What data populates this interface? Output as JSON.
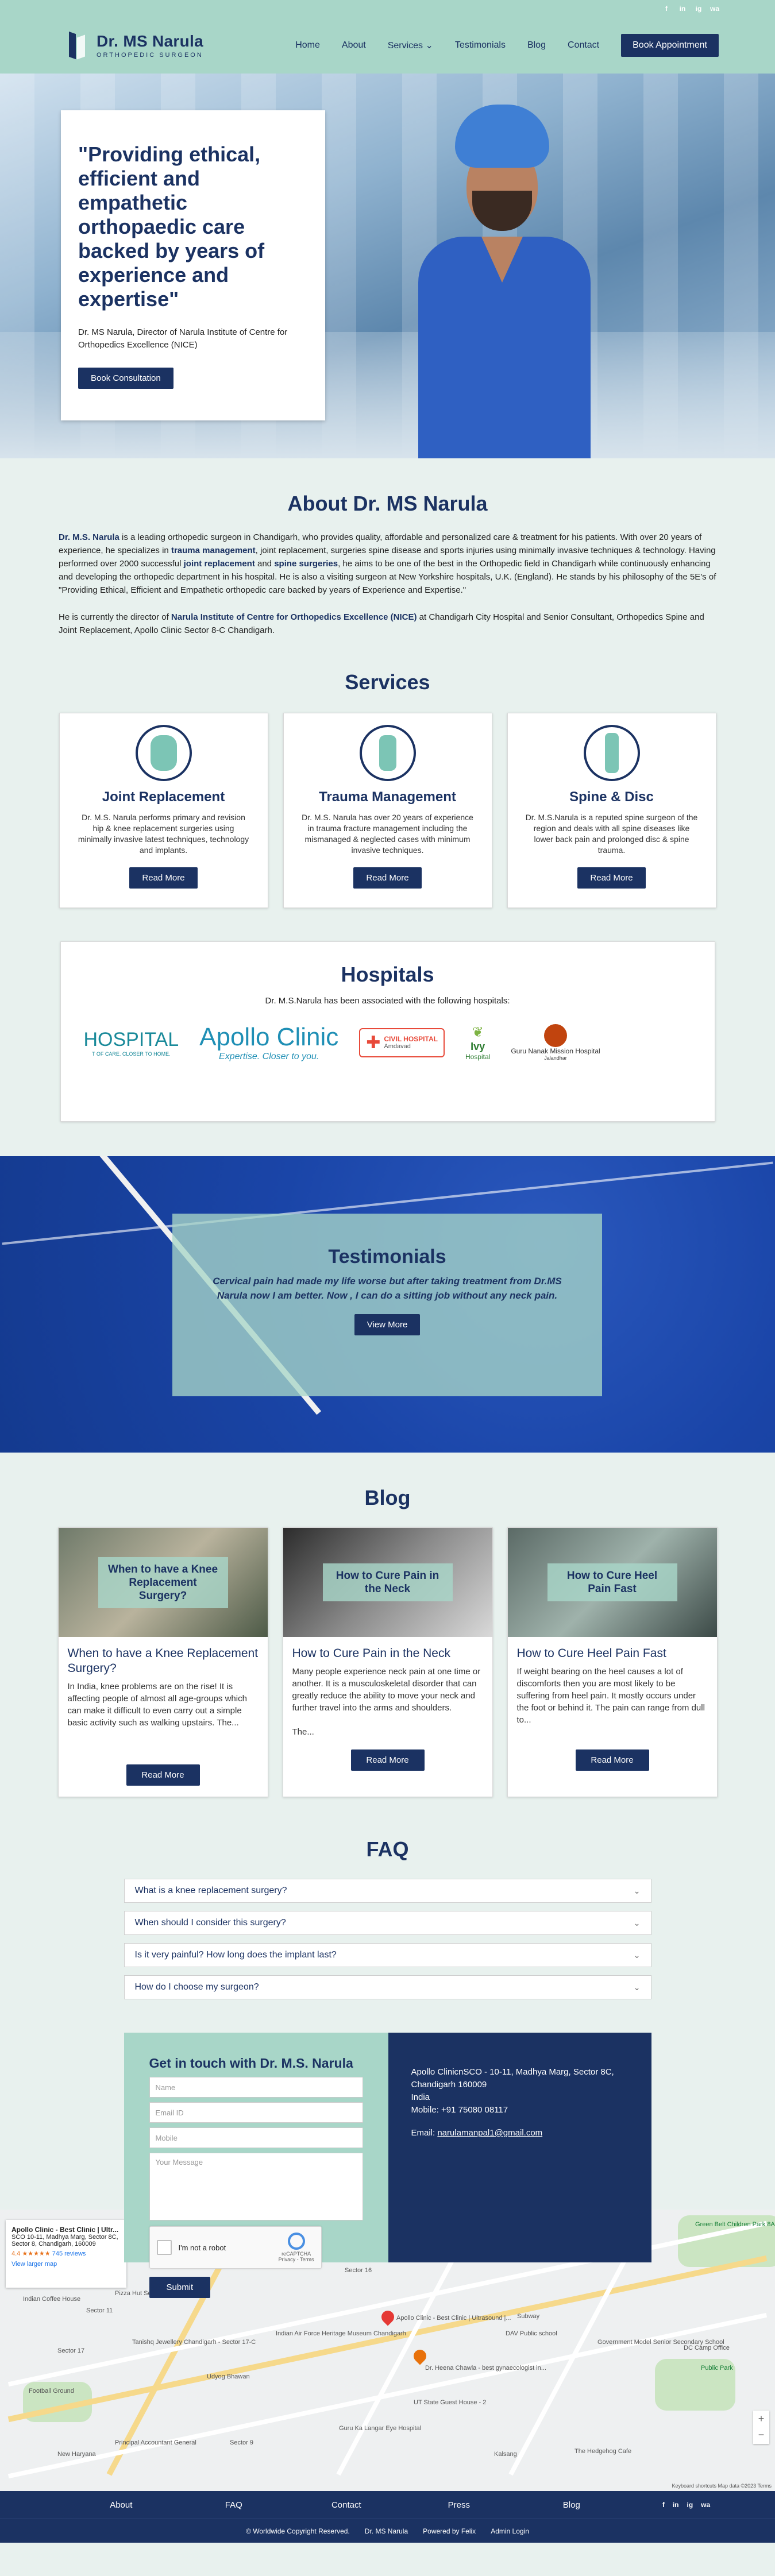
{
  "social": [
    "f",
    "in",
    "ig",
    "wa"
  ],
  "header": {
    "logo_name": "Dr. MS Narula",
    "logo_sub": "ORTHOPEDIC SURGEON",
    "nav": [
      "Home",
      "About",
      "Services",
      "Testimonials",
      "Blog",
      "Contact"
    ],
    "services_chevron": "⌄",
    "book_label": "Book Appointment"
  },
  "hero": {
    "quote": "\"Providing ethical, efficient and empathetic orthopaedic care backed by years of experience and expertise\"",
    "byline": "Dr. MS Narula, Director of Narula Institute of Centre for Orthopedics Excellence (NICE)",
    "cta": "Book Consultation"
  },
  "about": {
    "title": "About Dr. MS Narula",
    "p1_name": "Dr. M.S. Narula",
    "p1_a": " is a leading orthopedic surgeon in Chandigarh, who provides quality, affordable and personalized care & treatment for his patients. With over 20 years of experience, he specializes in ",
    "p1_hl1": "trauma management",
    "p1_b": ", joint replacement, surgeries spine disease and sports injuries using minimally invasive techniques & technology. Having performed over 2000 successful ",
    "p1_hl2": "joint replacement",
    "p1_c": " and ",
    "p1_hl3": "spine surgeries",
    "p1_d": ", he aims to be one of the best in the Orthopedic field in Chandigarh while continuously enhancing and developing the orthopedic department in his hospital. He is also a visiting surgeon at New Yorkshire hospitals, U.K. (England). He stands by his philosophy of the 5E's of \"Providing Ethical, Efficient and Empathetic orthopedic care backed by years of Experience and Expertise.\"",
    "p2_a": "He is currently the director of ",
    "p2_hl": "Narula Institute of Centre for Orthopedics Excellence (NICE)",
    "p2_b": " at Chandigarh City Hospital and Senior Consultant, Orthopedics Spine and Joint Replacement, Apollo Clinic Sector 8-C Chandigarh."
  },
  "services": {
    "title": "Services",
    "items": [
      {
        "icon": "knee-joint-icon",
        "title": "Joint Replacement",
        "text": "Dr. M.S. Narula performs primary and revision hip & knee replacement surgeries using minimally invasive latest techniques, technology and implants.",
        "button": "Read More"
      },
      {
        "icon": "bone-fracture-icon",
        "title": "Trauma Management",
        "text": "Dr. M.S. Narula has over 20 years of experience in trauma fracture management including the mismanaged & neglected cases with minimum invasive techniques.",
        "button": "Read More"
      },
      {
        "icon": "spine-icon",
        "title": "Spine & Disc",
        "text": "Dr. M.S.Narula is a reputed spine surgeon of the region and deals with all spine diseases like lower back pain and prolonged disc & spine trauma.",
        "button": "Read More"
      }
    ]
  },
  "hospitals": {
    "title": "Hospitals",
    "intro": "Dr. M.S.Narula has been associated with the following hospitals:",
    "logos": [
      {
        "main": "HOSPITAL",
        "sub": "T OF CARE. CLOSER TO HOME."
      },
      {
        "main": "Apollo Clinic",
        "sub": "Expertise. Closer to you."
      },
      {
        "main": "CIVIL HOSPITAL",
        "sub": "Amdavad"
      },
      {
        "main": "Ivy",
        "sub": "Hospital"
      },
      {
        "main": "Guru Nanak Mission Hospital",
        "sub": "Jalandhar"
      }
    ]
  },
  "testimonials": {
    "title": "Testimonials",
    "quote": "Cervical pain had made my life worse but after taking treatment from Dr.MS Narula now I am better. Now , I can do a sitting job without any neck pain.",
    "button": "View More"
  },
  "blog": {
    "title": "Blog",
    "posts": [
      {
        "overlay": "When to have a Knee Replacement Surgery?",
        "title": "When to have a Knee Replacement Surgery?",
        "excerpt": "In India, knee problems are on the rise! It is affecting people of almost all age-groups which can make it difficult to even carry out a simple basic activity such as walking upstairs. The...",
        "button": "Read More"
      },
      {
        "overlay": "How to Cure Pain in the Neck",
        "title": "How to Cure Pain in the Neck",
        "excerpt": "Many people experience neck pain at one time or another. It is a musculoskeletal disorder that can greatly reduce the ability to move your neck and further travel into the arms and shoulders.\n\nThe...",
        "button": "Read More"
      },
      {
        "overlay": "How to Cure Heel Pain Fast",
        "title": "How to Cure Heel Pain Fast",
        "excerpt": "If weight bearing on the heel causes a lot of discomforts then you are most likely to be suffering from heel pain. It mostly occurs under the foot or behind it. The pain can range from dull to...",
        "button": "Read More"
      }
    ]
  },
  "faq": {
    "title": "FAQ",
    "items": [
      "What is a knee replacement surgery?",
      "When should I consider this surgery?",
      "Is it very painful? How long does the implant last?",
      "How do I choose my surgeon?"
    ]
  },
  "contact": {
    "title": "Get in touch with Dr. M.S. Narula",
    "placeholders": {
      "name": "Name",
      "email": "Email ID",
      "mobile": "Mobile",
      "message": "Your Message"
    },
    "captcha_label": "I'm not a robot",
    "captcha_brand": "reCAPTCHA",
    "captcha_links": "Privacy - Terms",
    "submit": "Submit",
    "address": "Apollo ClinicnSCO - 10-11, Madhya Marg, Sector 8C, Chandigarh 160009",
    "country": "India",
    "mobile": "Mobile: +91 75080 08117",
    "email_label": "Email: ",
    "email": "narulamanpal1@gmail.com"
  },
  "map": {
    "card_title": "Apollo Clinic - Best Clinic | Ultr...",
    "card_addr": "SCO 10-11, Madhya Marg, Sector 8C, Sector 8, Chandigarh, 160009",
    "rating": "4.4 ★★★★★",
    "reviews": "745 reviews",
    "view_larger": "View larger map",
    "labels": [
      "Sector 11",
      "Pizza Hut Sector 11",
      "Indian Coffee House",
      "Sector 17",
      "Tanishq Jewellery Chandigarh - Sector 17-C",
      "Indian Air Force Heritage Museum Chandigarh",
      "Apollo Clinic - Best Clinic | Ultrasound |...",
      "DAV Public school",
      "Government Model Senior Secondary School",
      "DC Camp Office",
      "Public Park",
      "Green Belt Children Park 8A",
      "Football Ground",
      "Udyog Bhawan",
      "Dr. Heena Chawla - best gynaecologist in...",
      "UT State Guest House - 2",
      "Guru Ka Langar Eye Hospital",
      "Sector 9",
      "Kalsang",
      "The Hedgehog Cafe",
      "New Haryana",
      "Principal Accountant General",
      "Subway",
      "Sector 16"
    ],
    "footer": "Keyboard shortcuts   Map data ©2023   Terms"
  },
  "footer": {
    "nav": [
      "About",
      "FAQ",
      "Contact",
      "Press",
      "Blog"
    ],
    "copy": [
      "© Worldwide Copyright Reserved.",
      "Dr. MS Narula",
      "Powered by Felix",
      "Admin Login"
    ]
  },
  "colors": {
    "navy": "#1b3262",
    "mint": "#a8d6c8",
    "bg": "#e8f1ee"
  }
}
